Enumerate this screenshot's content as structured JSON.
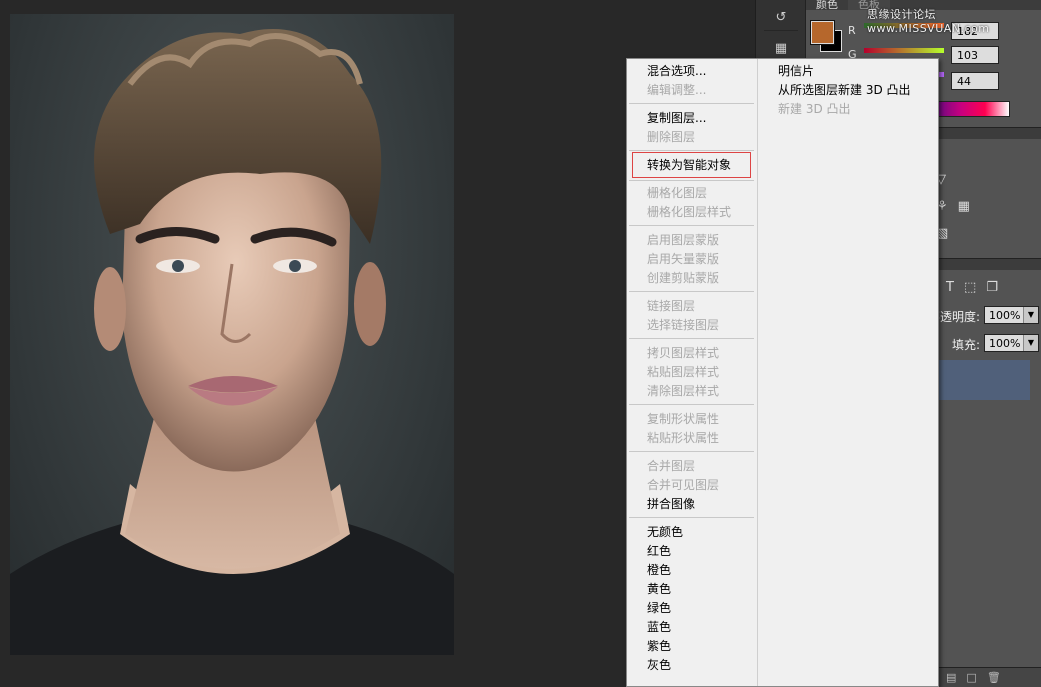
{
  "color_panel": {
    "tab_active": "颜色",
    "tab_inactive": "色板",
    "r_label": "R",
    "g_label": "G",
    "r_value": "182",
    "g_value": "103",
    "b_value": "44",
    "fg_color": "#b6672c",
    "bg_color": "#000000"
  },
  "watermark": "思缘设计论坛 www.MISSVUAN.com",
  "layers_panel": {
    "opacity_label": "不透明度:",
    "opacity_value": "100%",
    "fill_label": "填充:",
    "fill_value": "100%"
  },
  "context_menu": {
    "left": {
      "blend_options": "混合选项...",
      "edit_adjustment": "编辑调整...",
      "duplicate_layer": "复制图层...",
      "delete_layer": "删除图层",
      "convert_smart_object": "转换为智能对象",
      "rasterize_layer": "栅格化图层",
      "rasterize_layer_style": "栅格化图层样式",
      "enable_layer_mask": "启用图层蒙版",
      "enable_vector_mask": "启用矢量蒙版",
      "create_clipping_mask": "创建剪贴蒙版",
      "link_layers": "链接图层",
      "select_linked_layers": "选择链接图层",
      "copy_layer_style": "拷贝图层样式",
      "paste_layer_style": "粘贴图层样式",
      "clear_layer_style": "清除图层样式",
      "copy_shape_attrs": "复制形状属性",
      "paste_shape_attrs": "粘贴形状属性",
      "merge_layers": "合并图层",
      "merge_visible": "合并可见图层",
      "flatten_image": "拼合图像",
      "no_color": "无颜色",
      "red": "红色",
      "orange": "橙色",
      "yellow": "黄色",
      "green": "绿色",
      "blue": "蓝色",
      "violet": "紫色",
      "gray": "灰色"
    },
    "right": {
      "postcard": "明信片",
      "new_3d_from_selected": "从所选图层新建 3D 凸出",
      "new_3d_extrusion": "新建 3D 凸出"
    }
  },
  "icons": {
    "history": "history-icon",
    "properties": "properties-icon",
    "triangle": "triangle-icon",
    "grid": "grid-icon",
    "type_tool": "type-icon",
    "transform": "transform-icon",
    "trash": "trash-icon"
  }
}
